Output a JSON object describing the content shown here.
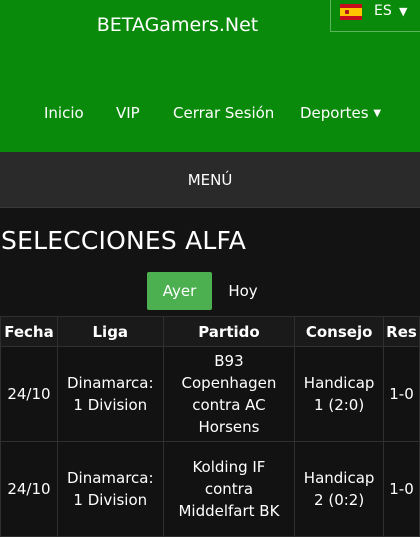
{
  "header": {
    "site_title": "BETAGamers.Net",
    "language": {
      "code": "ES",
      "flag_icon": "spain-flag-icon",
      "caret_icon": "caret-down-icon"
    },
    "nav": [
      {
        "label": "Inicio"
      },
      {
        "label": "VIP"
      },
      {
        "label": "Cerrar Sesión"
      },
      {
        "label": "Deportes",
        "caret_icon": "caret-down-icon"
      }
    ],
    "brand_color": "#0a8a0a"
  },
  "menu": {
    "label": "MENÚ"
  },
  "page_title": "SELECCIONES ALFA",
  "tabs": [
    {
      "label": "Ayer",
      "active": true,
      "color": "#4caf50"
    },
    {
      "label": "Hoy",
      "active": false
    }
  ],
  "table": {
    "columns": [
      "Fecha",
      "Liga",
      "Partido",
      "Consejo",
      "Res"
    ],
    "rows": [
      {
        "fecha": "24/10",
        "liga": [
          "Dinamarca:",
          "1 Division"
        ],
        "partido": [
          "B93",
          "Copenhagen",
          "contra AC",
          "Horsens"
        ],
        "consejo": [
          "Handicap",
          "1 (2:0)"
        ],
        "res": "1-0"
      },
      {
        "fecha": "24/10",
        "liga": [
          "Dinamarca:",
          "1 Division"
        ],
        "partido": [
          "Kolding IF",
          "contra",
          "Middelfart BK"
        ],
        "consejo": [
          "Handicap",
          "2 (0:2)"
        ],
        "res": "1-0"
      }
    ]
  }
}
